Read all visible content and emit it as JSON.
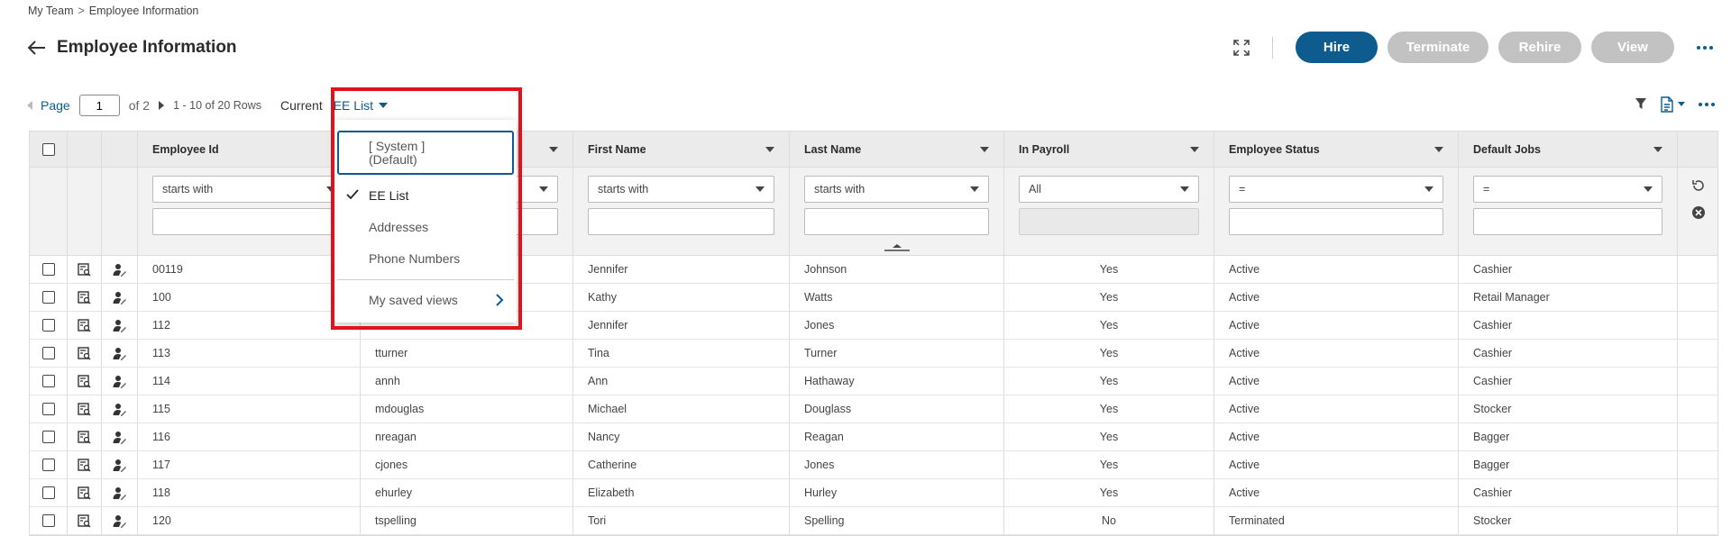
{
  "breadcrumb": {
    "parent": "My Team",
    "separator": ">",
    "current": "Employee Information"
  },
  "header": {
    "title": "Employee Information"
  },
  "actions": {
    "hire": "Hire",
    "terminate": "Terminate",
    "rehire": "Rehire",
    "view": "View"
  },
  "pager": {
    "page_label": "Page",
    "page_value": "1",
    "of_label": "of 2",
    "rows_label": "1 - 10 of 20 Rows",
    "current_label": "Current",
    "current_view": "EE List"
  },
  "view_menu": {
    "system_default": "[ System ]\n(Default)",
    "items": [
      "EE List",
      "Addresses",
      "Phone Numbers"
    ],
    "saved_views": "My saved views"
  },
  "columns": {
    "employee_id": "Employee Id",
    "first_name": "First Name",
    "last_name": "Last Name",
    "in_payroll": "In Payroll",
    "employee_status": "Employee Status",
    "default_jobs": "Default Jobs"
  },
  "filters": {
    "employee_id": "starts with",
    "first_name": "starts with",
    "last_name": "starts with",
    "in_payroll": "All",
    "employee_status": "=",
    "default_jobs": "="
  },
  "rows": [
    {
      "id": "00119",
      "user": "",
      "first": "Jennifer",
      "last": "Johnson",
      "payroll": "Yes",
      "status": "Active",
      "job": "Cashier"
    },
    {
      "id": "100",
      "user": "",
      "first": "Kathy",
      "last": "Watts",
      "payroll": "Yes",
      "status": "Active",
      "job": "Retail Manager"
    },
    {
      "id": "112",
      "user": "",
      "first": "Jennifer",
      "last": "Jones",
      "payroll": "Yes",
      "status": "Active",
      "job": "Cashier"
    },
    {
      "id": "113",
      "user": "tturner",
      "first": "Tina",
      "last": "Turner",
      "payroll": "Yes",
      "status": "Active",
      "job": "Cashier"
    },
    {
      "id": "114",
      "user": "annh",
      "first": "Ann",
      "last": "Hathaway",
      "payroll": "Yes",
      "status": "Active",
      "job": "Cashier"
    },
    {
      "id": "115",
      "user": "mdouglas",
      "first": "Michael",
      "last": "Douglass",
      "payroll": "Yes",
      "status": "Active",
      "job": "Stocker"
    },
    {
      "id": "116",
      "user": "nreagan",
      "first": "Nancy",
      "last": "Reagan",
      "payroll": "Yes",
      "status": "Active",
      "job": "Bagger"
    },
    {
      "id": "117",
      "user": "cjones",
      "first": "Catherine",
      "last": "Jones",
      "payroll": "Yes",
      "status": "Active",
      "job": "Bagger"
    },
    {
      "id": "118",
      "user": "ehurley",
      "first": "Elizabeth",
      "last": "Hurley",
      "payroll": "Yes",
      "status": "Active",
      "job": "Cashier"
    },
    {
      "id": "120",
      "user": "tspelling",
      "first": "Tori",
      "last": "Spelling",
      "payroll": "No",
      "status": "Terminated",
      "job": "Stocker"
    }
  ],
  "colors": {
    "primary": "#0d5b8f",
    "disabled": "#c2c2c2",
    "highlight": "#e0121b"
  }
}
